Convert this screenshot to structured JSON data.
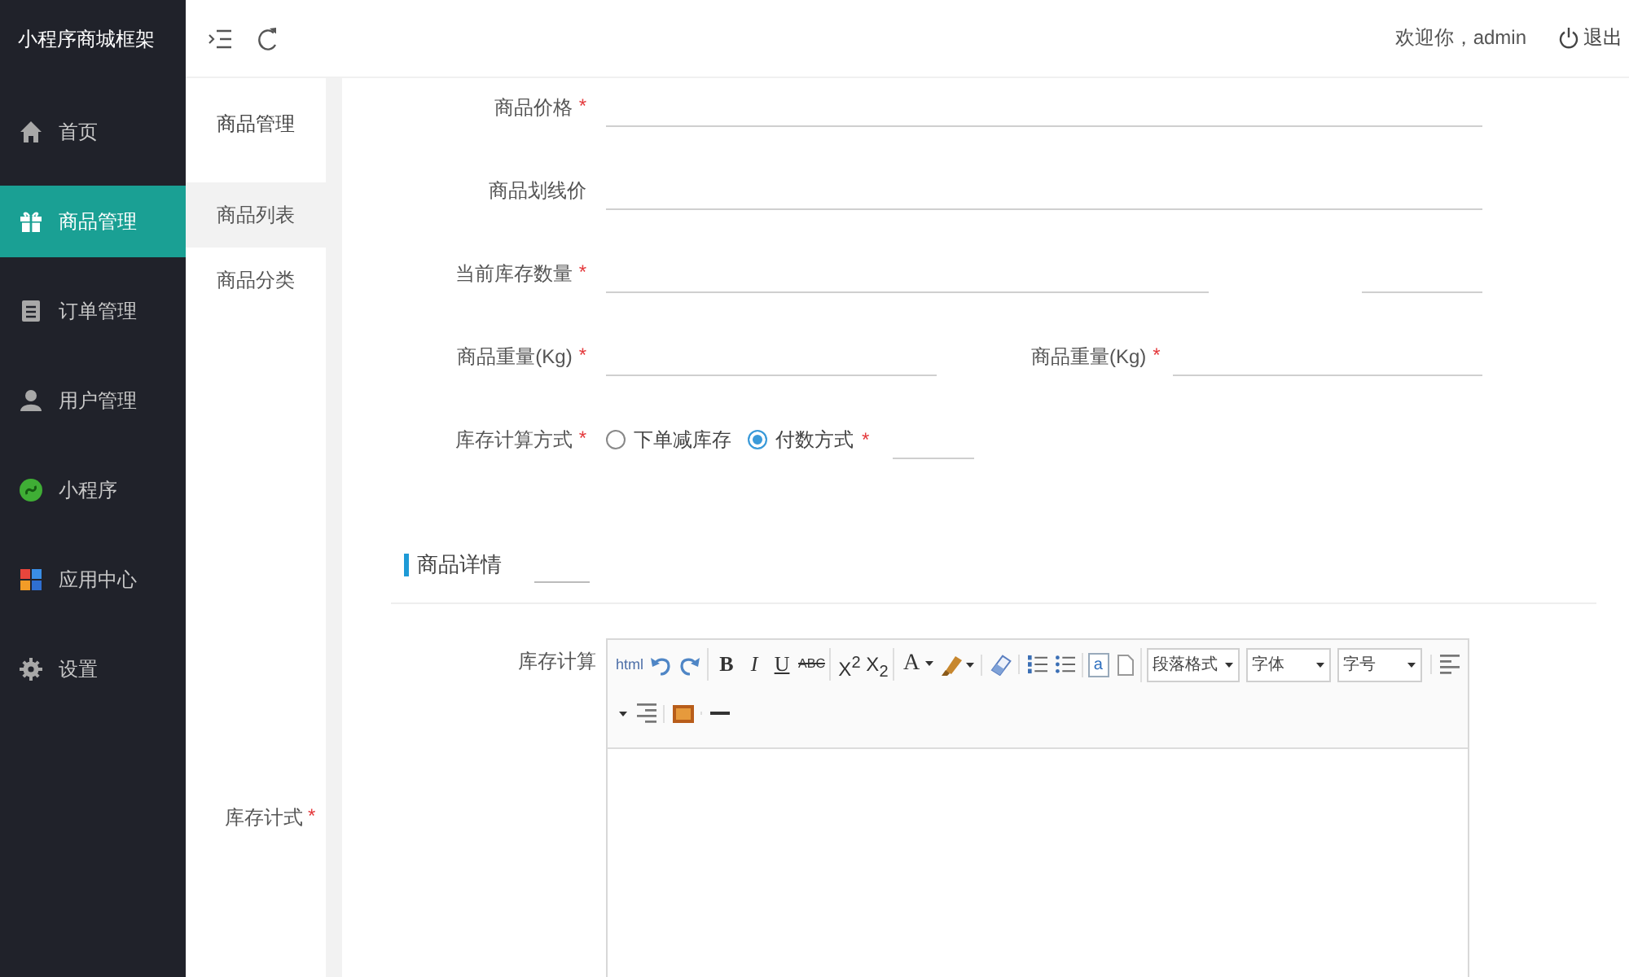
{
  "sidebar": {
    "logo": "小程序商城框架",
    "items": [
      {
        "label": "首页",
        "selected": false
      },
      {
        "label": "商品管理",
        "selected": true
      },
      {
        "label": "订单管理",
        "selected": false
      },
      {
        "label": "用户管理",
        "selected": false
      },
      {
        "label": "小程序",
        "selected": false
      },
      {
        "label": "应用中心",
        "selected": false
      },
      {
        "label": "设置",
        "selected": false
      }
    ]
  },
  "topbar": {
    "welcome": "欢迎你，admin",
    "logout": "退出"
  },
  "subnav": {
    "title": "商品管理",
    "items": [
      {
        "label": "商品列表",
        "selected": true
      },
      {
        "label": "商品分类",
        "selected": false
      }
    ],
    "note": {
      "label": "库存计式",
      "mark": "*"
    }
  },
  "form": {
    "rows": [
      {
        "fields": [
          {
            "kind": "text",
            "label": "商品价格",
            "mark": "*"
          }
        ]
      },
      {
        "fields": [
          {
            "kind": "text",
            "label": "商品划线价"
          }
        ]
      },
      {
        "fields": [
          {
            "kind": "text",
            "label": "当前库存数量",
            "mark": "*"
          },
          {
            "kind": "blank"
          }
        ]
      },
      {
        "fields": [
          {
            "kind": "text",
            "label": "商品重量(Kg)",
            "mark": "*"
          },
          {
            "kind": "text",
            "label": "商品重量(Kg)",
            "mark": "*"
          }
        ]
      },
      {
        "fields": [
          {
            "kind": "radio",
            "label": "库存计算方式",
            "mark": "*",
            "options": [
              {
                "label": "下单减库存",
                "selected": false
              },
              {
                "label": "付数方式",
                "mark": "*",
                "selected": true
              }
            ]
          },
          {
            "kind": "blank"
          }
        ]
      }
    ]
  },
  "details": {
    "heading": "商品详情",
    "editor": {
      "label": "库存计算",
      "toolbar_rows": [
        [
          [
            {
              "kind": "source",
              "label": "html"
            },
            {
              "kind": "undo"
            },
            {
              "kind": "redo"
            }
          ],
          [
            {
              "kind": "bold",
              "label": "B"
            },
            {
              "kind": "italic",
              "label": "I"
            },
            {
              "kind": "underline",
              "label": "U"
            },
            {
              "kind": "strike",
              "label": "ABC"
            }
          ],
          [
            {
              "kind": "superscript",
              "label": "X$^{2}$"
            },
            {
              "kind": "subscript",
              "label": "X$_{2}$"
            }
          ],
          [
            {
              "kind": "fontcolor",
              "label": "A"
            },
            {
              "kind": "highlight"
            }
          ],
          [
            {
              "kind": "eraser"
            }
          ],
          [
            {
              "kind": "orderedlist"
            },
            {
              "kind": "bulletlist"
            }
          ],
          [
            {
              "kind": "anchor",
              "label": "a"
            },
            {
              "kind": "page"
            }
          ],
          [
            {
              "kind": "select",
              "label": "段落格式"
            },
            {
              "kind": "select",
              "label": "字体"
            },
            {
              "kind": "select",
              "label": "字号"
            }
          ],
          [
            {
              "kind": "alignleft"
            }
          ]
        ],
        [
          [
            {
              "kind": "dropdown"
            },
            {
              "kind": "alignright"
            }
          ],
          [
            {
              "kind": "image"
            }
          ],
          [
            {
              "kind": "hr"
            }
          ]
        ]
      ]
    }
  }
}
